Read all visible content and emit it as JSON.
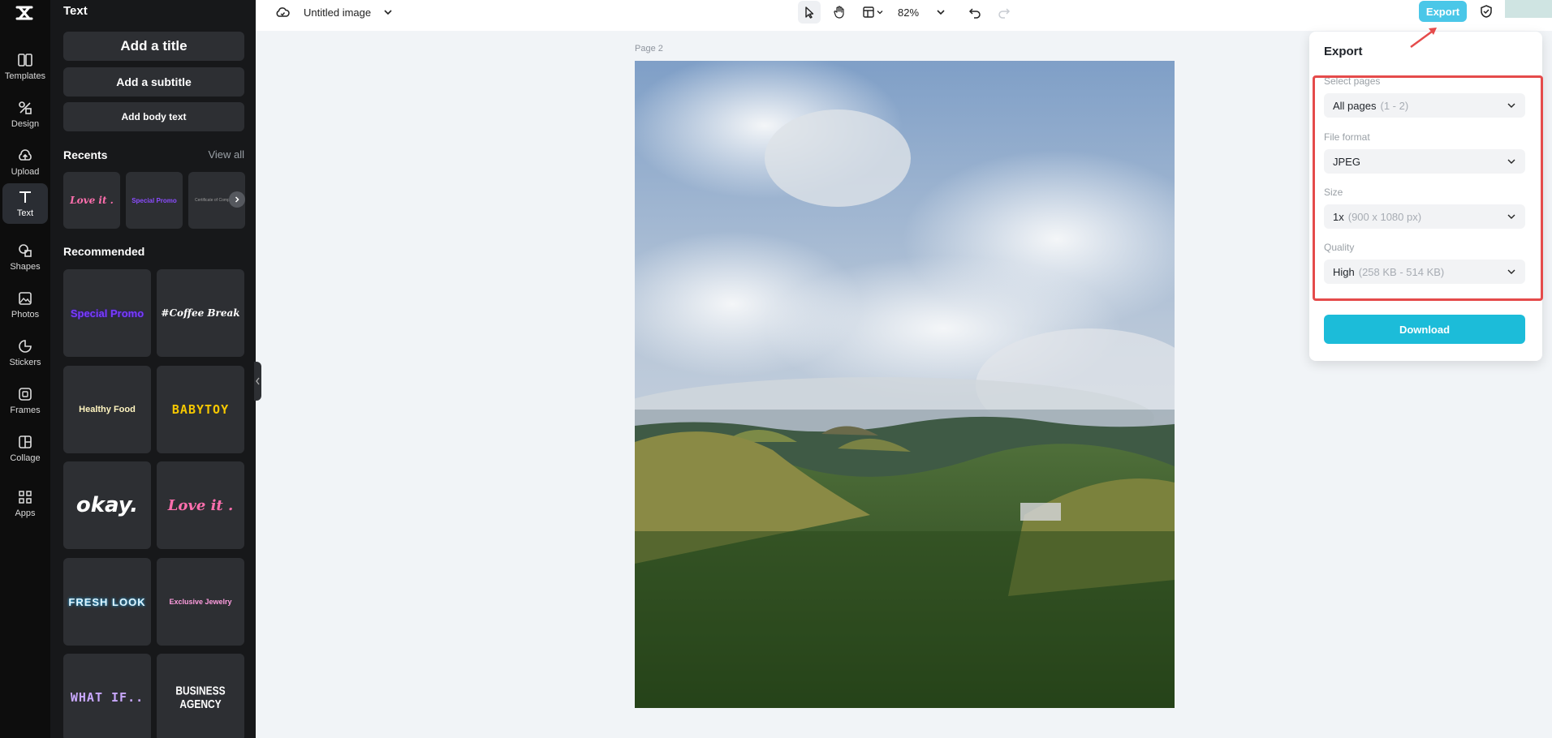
{
  "rail": {
    "items": [
      {
        "label": "Templates",
        "icon": "templates-icon"
      },
      {
        "label": "Design",
        "icon": "design-icon"
      },
      {
        "label": "Upload",
        "icon": "upload-icon"
      },
      {
        "label": "Text",
        "icon": "text-icon",
        "active": true
      },
      {
        "label": "Shapes",
        "icon": "shapes-icon"
      },
      {
        "label": "Photos",
        "icon": "photos-icon"
      },
      {
        "label": "Stickers",
        "icon": "stickers-icon"
      },
      {
        "label": "Frames",
        "icon": "frames-icon"
      },
      {
        "label": "Collage",
        "icon": "collage-icon"
      },
      {
        "label": "Apps",
        "icon": "apps-icon"
      }
    ]
  },
  "panel": {
    "title": "Text",
    "add_title": "Add a title",
    "add_subtitle": "Add a subtitle",
    "add_body": "Add body text",
    "recents_title": "Recents",
    "view_all": "View all",
    "recents": [
      "Love it .",
      "Special Promo",
      "Certificate of Completion"
    ],
    "recommended_title": "Recommended",
    "recommended": [
      "Special Promo",
      "#Coffee Break",
      "Healthy Food",
      "BABYTOY",
      "okay.",
      "Love it .",
      "FRESH LOOK",
      "Exclusive Jewelry",
      "WHAT IF..",
      "BUSINESS AGENCY"
    ]
  },
  "topbar": {
    "doc_title": "Untitled image",
    "zoom": "82%",
    "export_label": "Export"
  },
  "canvas": {
    "page_label": "Page 2"
  },
  "export_panel": {
    "title": "Export",
    "select_pages_label": "Select pages",
    "select_pages_value": "All pages",
    "select_pages_sub": "(1 - 2)",
    "file_format_label": "File format",
    "file_format_value": "JPEG",
    "size_label": "Size",
    "size_value": "1x",
    "size_sub": "(900 x 1080 px)",
    "quality_label": "Quality",
    "quality_value": "High",
    "quality_sub": "(258 KB - 514 KB)",
    "download_label": "Download"
  },
  "colors": {
    "accent": "#1cbcd9",
    "export_button": "#4ac7e8",
    "highlight": "#e54b4b",
    "rail_bg": "#0d0d0d",
    "panel_bg": "#17181a"
  }
}
